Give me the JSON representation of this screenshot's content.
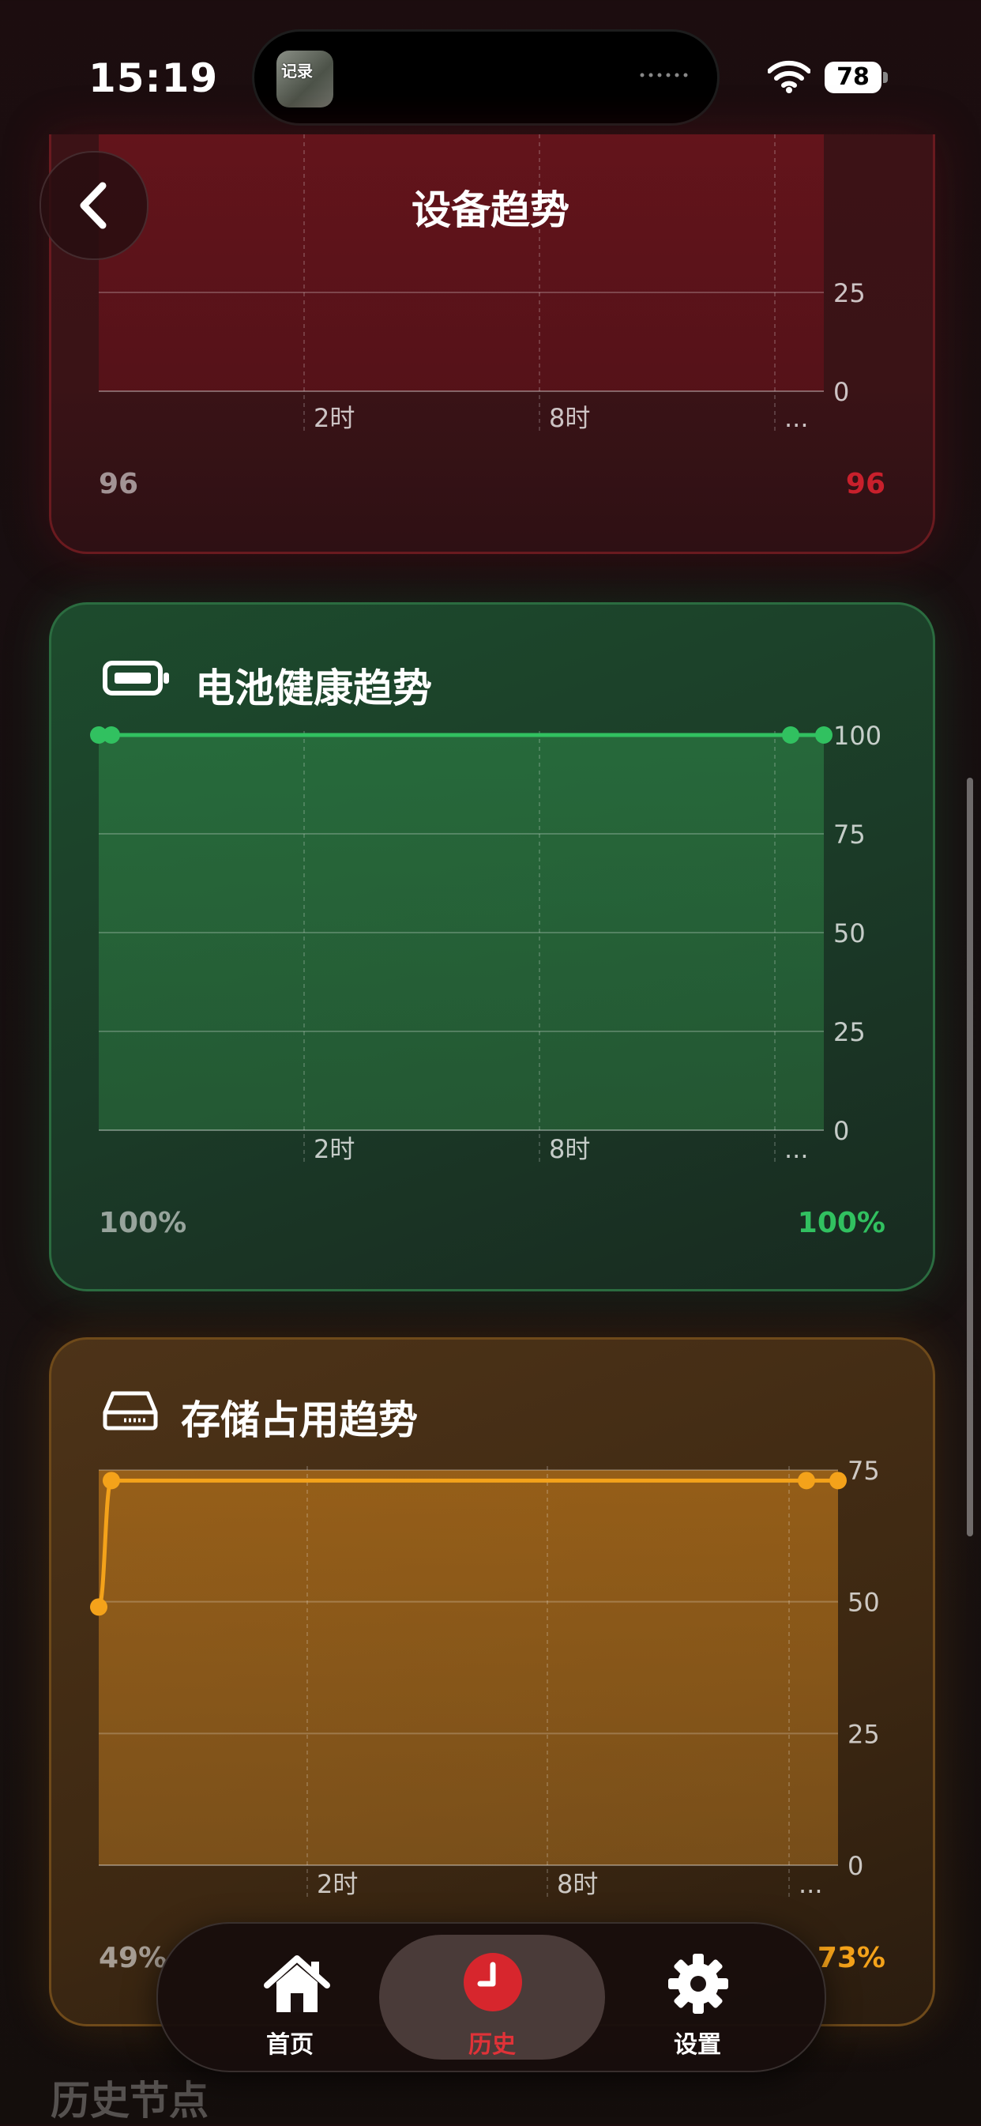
{
  "status": {
    "time": "15:19",
    "battery": "78",
    "app_icon_text": "记录"
  },
  "nav": {
    "title": "设备趋势"
  },
  "colors": {
    "red": "#c8202c",
    "green": "#31c160",
    "orange": "#f4a21a"
  },
  "cards": {
    "temperature": {
      "x_ticks": [
        "2时",
        "8时",
        "..."
      ],
      "y_ticks": [
        "25",
        "0"
      ],
      "first_value": "96",
      "last_value": "96"
    },
    "battery": {
      "title": "电池健康趋势",
      "icon": "battery-icon",
      "x_ticks": [
        "2时",
        "8时",
        "..."
      ],
      "y_ticks": [
        "100",
        "75",
        "50",
        "25",
        "0"
      ],
      "first_value": "100%",
      "last_value": "100%"
    },
    "storage": {
      "title": "存储占用趋势",
      "icon": "storage-drive-icon",
      "x_ticks": [
        "2时",
        "8时",
        "..."
      ],
      "y_ticks": [
        "75",
        "50",
        "25",
        "0"
      ],
      "first_value": "49%",
      "last_value": "73%"
    }
  },
  "chart_data": [
    {
      "type": "area",
      "series": [
        {
          "values": [
            100,
            100,
            100,
            100
          ]
        }
      ],
      "y_ticks": [
        0,
        25,
        50,
        75,
        100
      ],
      "ylim": [
        0,
        100
      ],
      "x_ticks": [
        "2时",
        "8时",
        "..."
      ],
      "grid": true
    },
    {
      "type": "area",
      "series": [
        {
          "values": [
            49,
            73,
            73,
            73
          ]
        }
      ],
      "y_ticks": [
        0,
        25,
        50,
        75
      ],
      "ylim": [
        0,
        75
      ],
      "x_ticks": [
        "2时",
        "8时",
        "..."
      ],
      "grid": true
    }
  ],
  "section": {
    "title": "历史节点"
  },
  "tabs": [
    {
      "label": "首页",
      "icon": "home-icon",
      "active": false
    },
    {
      "label": "历史",
      "icon": "clock-icon",
      "active": true
    },
    {
      "label": "设置",
      "icon": "gear-icon",
      "active": false
    }
  ]
}
